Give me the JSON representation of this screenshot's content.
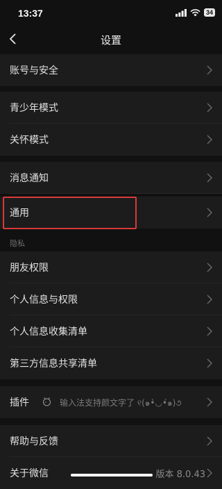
{
  "status_bar": {
    "time": "13:37",
    "battery": "34"
  },
  "nav": {
    "title": "设置"
  },
  "rows": {
    "account": "账号与安全",
    "youth_mode": "青少年模式",
    "care_mode": "关怀模式",
    "notifications": "消息通知",
    "general": "通用",
    "friend_permissions": "朋友权限",
    "personal_info": "个人信息与权限",
    "info_collection": "个人信息收集清单",
    "third_party": "第三方信息共享清单",
    "plugins": "插件",
    "plugins_desc": "输入法支持颜文字了 ୧(๑•̀◡•́๑)૭",
    "help": "帮助与反馈",
    "about": "关于微信",
    "version": "版本 8.0.43"
  },
  "sections": {
    "privacy": "隐私"
  },
  "colors": {
    "background": "#111111",
    "row_background": "#1c1c1c",
    "highlight": "#d83a3a"
  }
}
